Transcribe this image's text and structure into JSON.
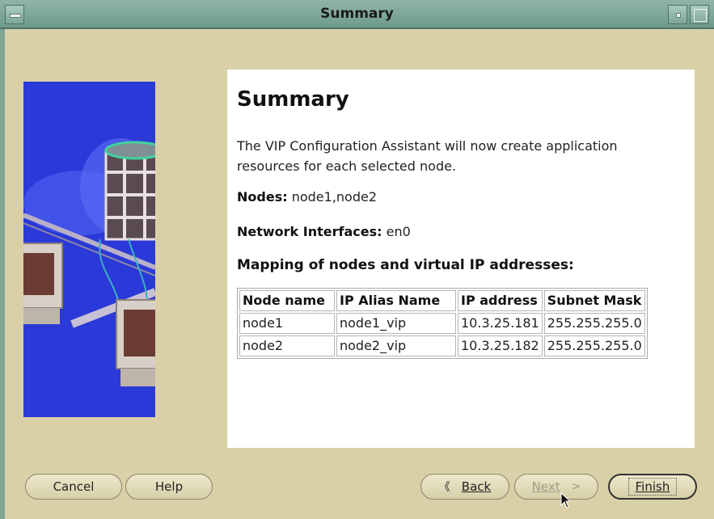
{
  "window": {
    "title": "Summary"
  },
  "page": {
    "heading": "Summary",
    "description": "The VIP Configuration Assistant will now create application resources for each selected node.",
    "nodes_label": "Nodes:",
    "nodes_value": "node1,node2",
    "interfaces_label": "Network Interfaces:",
    "interfaces_value": "en0",
    "mapping_title": "Mapping of nodes and virtual IP addresses:"
  },
  "table": {
    "headers": [
      "Node name",
      "IP Alias Name",
      "IP address",
      "Subnet Mask"
    ],
    "rows": [
      [
        "node1",
        "node1_vip",
        "10.3.25.181",
        "255.255.255.0"
      ],
      [
        "node2",
        "node2_vip",
        "10.3.25.182",
        "255.255.255.0"
      ]
    ]
  },
  "buttons": {
    "cancel": "Cancel",
    "help": "Help",
    "back": "Back",
    "next": "Next",
    "finish": "Finish"
  },
  "icons": {
    "menu": "window-menu-icon",
    "minimize": "minimize-icon",
    "maximize": "maximize-icon",
    "back_arrow": "chevron-left-icon",
    "next_arrow": "chevron-right-icon"
  },
  "colors": {
    "title_bar": "#7fa596",
    "background": "#d9d0a8",
    "illustration_bg": "#2b39d8"
  }
}
